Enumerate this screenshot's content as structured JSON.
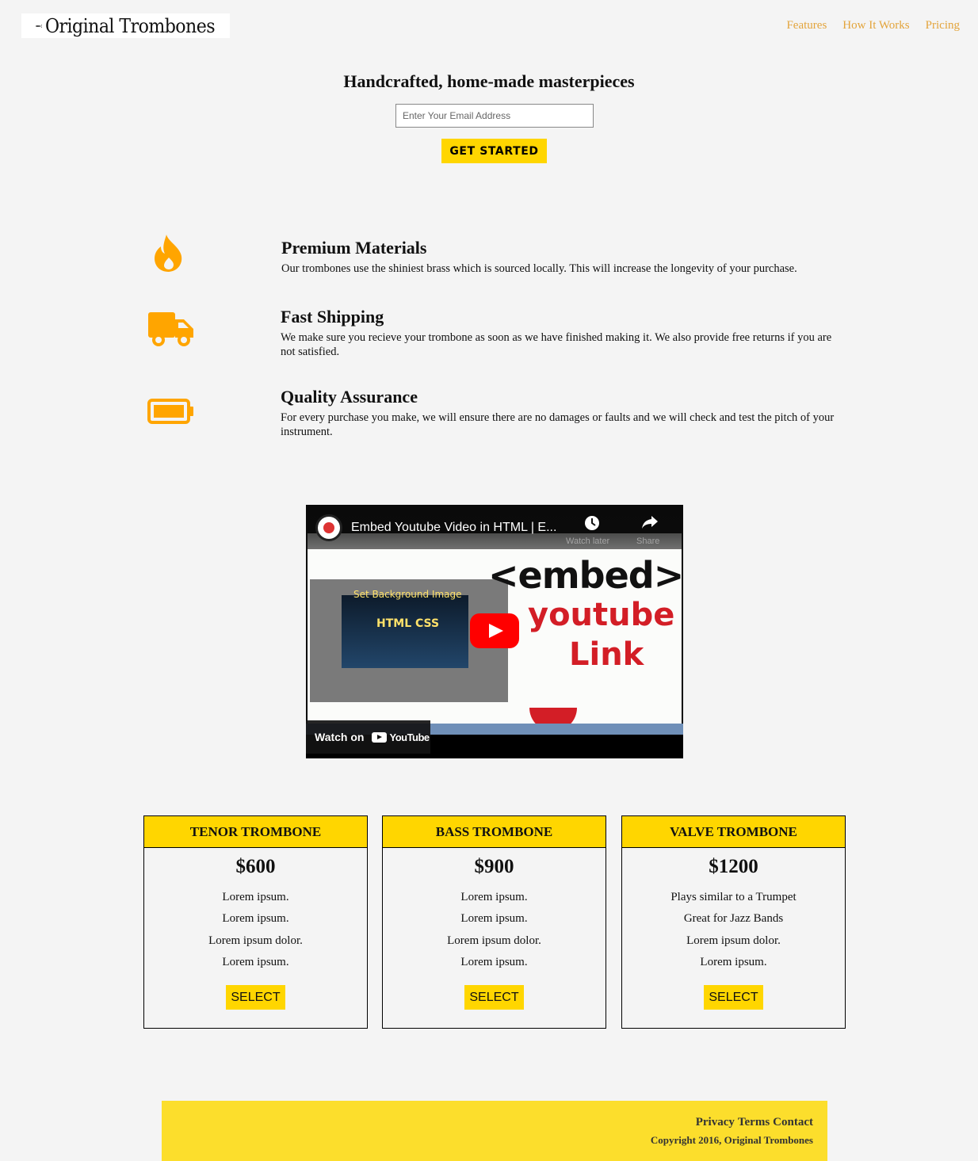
{
  "header": {
    "brand": "Original Trombones",
    "nav": [
      "Features",
      "How It Works",
      "Pricing"
    ]
  },
  "hero": {
    "title": "Handcrafted, home-made masterpieces",
    "email_placeholder": "Enter Your Email Address",
    "cta_label": "GET STARTED"
  },
  "features": [
    {
      "icon": "fire-icon",
      "title": "Premium Materials",
      "description": "Our trombones use the shiniest brass which is sourced locally. This will increase the longevity of your purchase."
    },
    {
      "icon": "truck-icon",
      "title": "Fast Shipping",
      "description": "We make sure you recieve your trombone as soon as we have finished making it. We also provide free returns if you are not satisfied."
    },
    {
      "icon": "battery-icon",
      "title": "Quality Assurance",
      "description": "For every purchase you make, we will ensure there are no damages or faults and we will check and test the pitch of your instrument."
    }
  ],
  "video": {
    "title": "Embed Youtube Video in HTML | E...",
    "watch_later": "Watch later",
    "share": "Share",
    "thumb_big_1": "<embed>",
    "thumb_big_2": "youtube",
    "thumb_big_3": "Link",
    "thumb_inner_1": "Set Background Image",
    "thumb_inner_2": "HTML CSS",
    "watch_on": "Watch on",
    "youtube": "YouTube"
  },
  "pricing": [
    {
      "name": "TENOR TROMBONE",
      "price": "$600",
      "features": [
        "Lorem ipsum.",
        "Lorem ipsum.",
        "Lorem ipsum dolor.",
        "Lorem ipsum."
      ],
      "button": "SELECT"
    },
    {
      "name": "BASS TROMBONE",
      "price": "$900",
      "features": [
        "Lorem ipsum.",
        "Lorem ipsum.",
        "Lorem ipsum dolor.",
        "Lorem ipsum."
      ],
      "button": "SELECT"
    },
    {
      "name": "VALVE TROMBONE",
      "price": "$1200",
      "features": [
        "Plays similar to a Trumpet",
        "Great for Jazz Bands",
        "Lorem ipsum dolor.",
        "Lorem ipsum."
      ],
      "button": "SELECT"
    }
  ],
  "footer": {
    "links": [
      "Privacy",
      "Terms",
      "Contact"
    ],
    "copyright": "Copyright 2016, Original Trombones"
  },
  "colors": {
    "accent": "#ffd600",
    "nav_link": "#e3a43b",
    "icon": "#ffa500",
    "footer_bg": "#fcde2c"
  }
}
